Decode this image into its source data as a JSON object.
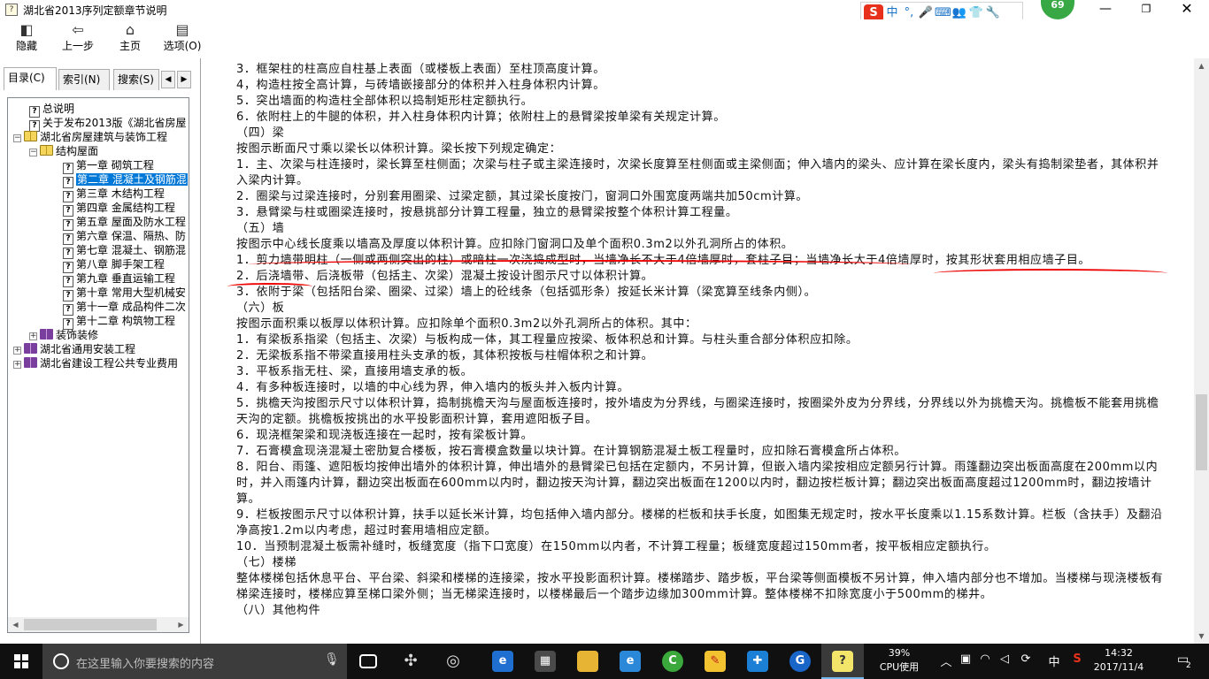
{
  "window": {
    "title": "湖北省2013序列定额章节说明",
    "app_icon_glyph": "?",
    "controls": {
      "min": "—",
      "max": "❐",
      "close": "✕"
    }
  },
  "ime": {
    "logo": "S",
    "items": [
      "中",
      "°,",
      "🎤",
      "⌨",
      "👥",
      "👕",
      "🔧"
    ],
    "badge": "69"
  },
  "toolbar": {
    "hide": {
      "label": "隐藏",
      "icon": "hide-icon"
    },
    "back": {
      "label": "上一步",
      "icon": "back-arrow-icon"
    },
    "home": {
      "label": "主页",
      "icon": "home-icon"
    },
    "options": {
      "label": "选项(O)",
      "icon": "options-icon"
    }
  },
  "tabs": {
    "contents": "目录(C)",
    "index": "索引(N)",
    "search": "搜索(S)",
    "left": "◀",
    "right": "▶"
  },
  "tree": [
    {
      "label": "总说明"
    },
    {
      "label": "关于发布2013版《湖北省房屋"
    },
    {
      "label": "湖北省房屋建筑与装饰工程"
    },
    {
      "label": "结构屋面"
    },
    {
      "label": "第一章  砌筑工程"
    },
    {
      "label": "第二章  混凝土及钢筋混"
    },
    {
      "label": "第三章  木结构工程"
    },
    {
      "label": "第四章  金属结构工程"
    },
    {
      "label": "第五章  屋面及防水工程"
    },
    {
      "label": "第六章  保温、隔热、防"
    },
    {
      "label": "第七章  混凝土、钢筋混"
    },
    {
      "label": "第八章  脚手架工程"
    },
    {
      "label": "第九章  垂直运输工程"
    },
    {
      "label": "第十章  常用大型机械安"
    },
    {
      "label": "第十一章  成品构件二次"
    },
    {
      "label": "第十二章  构筑物工程"
    },
    {
      "label": "装饰装修"
    },
    {
      "label": "湖北省通用安装工程"
    },
    {
      "label": "湖北省建设工程公共专业费用"
    }
  ],
  "content": {
    "paragraphs": [
      "3．框架柱的柱高应自柱基上表面（或楼板上表面）至柱顶高度计算。",
      "4，构造柱按全高计算，与砖墙嵌接部分的体积并入柱身体积内计算。",
      "5．突出墙面的构造柱全部体积以捣制矩形柱定额执行。",
      "6．依附柱上的牛腿的体积，并入柱身体积内计算；依附柱上的悬臂梁按单梁有关规定计算。",
      "（四）梁",
      "按图示断面尺寸乘以梁长以体积计算。梁长按下列规定确定：",
      "1．主、次梁与柱连接时，梁长算至柱侧面；次梁与柱子或主梁连接时，次梁长度算至柱侧面或主梁侧面；伸入墙内的梁头、应计算在梁长度内，梁头有捣制梁垫者，其体积并入梁内计算。",
      "2．圈梁与过梁连接时，分别套用圈梁、过梁定额，其过梁长度按门，窗洞口外围宽度两端共加50cm计算。",
      "3．悬臂梁与柱或圈梁连接时，按悬挑部分计算工程量，独立的悬臂梁按整个体积计算工程量。",
      "（五）墙",
      "按图示中心线长度乘以墙高及厚度以体积计算。应扣除门窗洞口及单个面积0.3m2以外孔洞所占的体积。",
      "1．剪力墙带明柱（一侧或两侧突出的柱）或暗柱一次浇捣成型时，当墙净长不大于4倍墙厚时，套柱子目；当墙净长大于4倍墙厚时，按其形状套用相应墙子目。",
      "2．后浇墙带、后浇板带（包括主、次梁）混凝土按设计图示尺寸以体积计算。",
      "3．依附于梁（包括阳台梁、圈梁、过梁）墙上的砼线条（包括弧形条）按延长米计算（梁宽算至线条内侧）。",
      "（六）板",
      "按图示面积乘以板厚以体积计算。应扣除单个面积0.3m2以外孔洞所占的体积。其中：",
      "1．有梁板系指梁（包括主、次梁）与板构成一体，其工程量应按梁、板体积总和计算。与柱头重合部分体积应扣除。",
      "2．无梁板系指不带梁直接用柱头支承的板，其体积按板与柱帽体积之和计算。",
      "3．平板系指无柱、梁，直接用墙支承的板。",
      "4．有多种板连接时，以墙的中心线为界，伸入墙内的板头并入板内计算。",
      "5．挑檐天沟按图示尺寸以体积计算，捣制挑檐天沟与屋面板连接时，按外墙皮为分界线，与圈梁连接时，按圈梁外皮为分界线，分界线以外为挑檐天沟。挑檐板不能套用挑檐天沟的定额。挑檐板按挑出的水平投影面积计算，套用遮阳板子目。",
      "6．现浇框架梁和现浇板连接在一起时，按有梁板计算。",
      "7．石膏模盒现浇混凝土密肋复合楼板，按石膏模盒数量以块计算。在计算钢筋混凝土板工程量时，应扣除石膏模盒所占体积。",
      "8．阳台、雨篷、遮阳板均按伸出墙外的体积计算，伸出墙外的悬臂梁已包括在定额内，不另计算，但嵌入墙内梁按相应定额另行计算。雨篷翻边突出板面高度在200mm以内时，并入雨篷内计算，翻边突出板面在600mm以内时，翻边按天沟计算，翻边突出板面在1200以内时，翻边按栏板计算；翻边突出板面高度超过1200mm时，翻边按墙计算。",
      "9．栏板按图示尺寸以体积计算，扶手以延长米计算，均包括伸入墙内部分。楼梯的栏板和扶手长度，如图集无规定时，按水平长度乘以1.15系数计算。栏板（含扶手）及翻沿净高按1.2m以内考虑，超过时套用墙相应定额。",
      "10．当预制混凝土板需补缝时，板缝宽度（指下口宽度）在150mm以内者，不计算工程量；板缝宽度超过150mm者，按平板相应定额执行。",
      "（七）楼梯",
      "整体楼梯包括休息平台、平台梁、斜梁和楼梯的连接梁，按水平投影面积计算。楼梯踏步、踏步板，平台梁等侧面模板不另计算，伸入墙内部分也不增加。当楼梯与现浇楼板有梯梁连接时，楼梯应算至梯口梁外侧；当无梯梁连接时，以楼梯最后一个踏步边缘加300mm计算。整体楼梯不扣除宽度小于500mm的梯井。",
      "（八）其他构件"
    ]
  },
  "taskbar": {
    "search_placeholder": "在这里输入你要搜索的内容",
    "cpu_percent": "39%",
    "cpu_label": "CPU使用",
    "ime_lang": "中",
    "ime_logo": "S",
    "time": "14:32",
    "date": "2017/11/4",
    "notif_count": "2",
    "apps": [
      "task-view",
      "fan",
      "browser-360",
      "edge",
      "store",
      "explorer",
      "ie",
      "green-app",
      "notes",
      "tool-app",
      "g-app",
      "help-app"
    ]
  }
}
